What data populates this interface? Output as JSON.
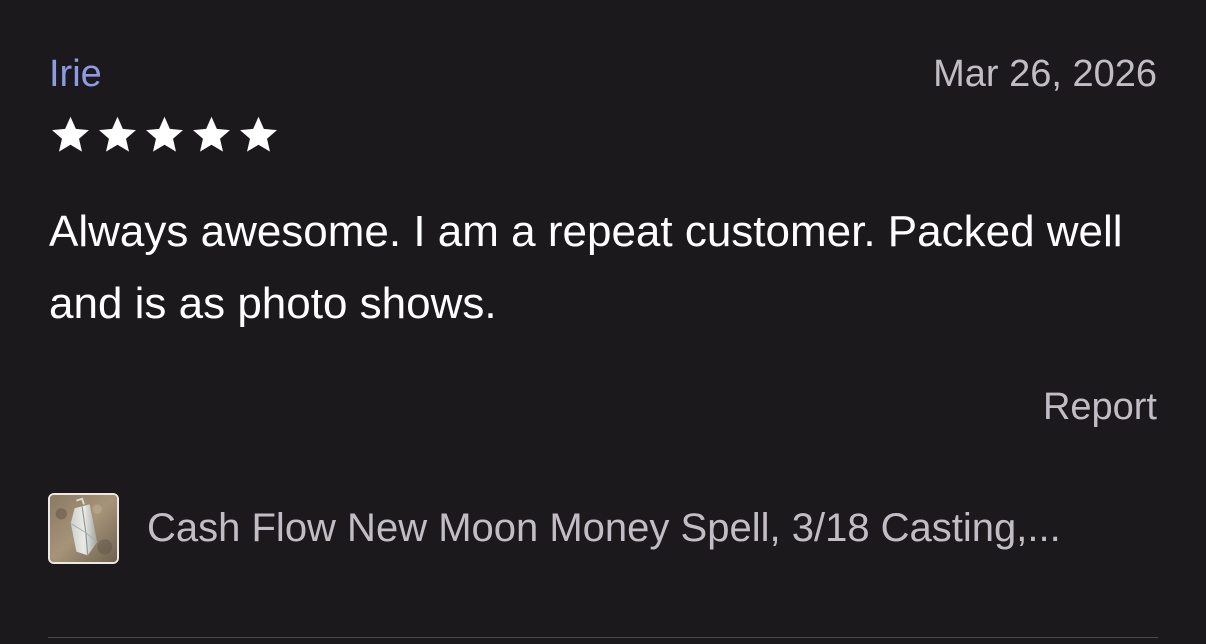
{
  "review": {
    "reviewer_name": "Irie",
    "date": "Mar 26, 2026",
    "rating": 5,
    "rating_max": 5,
    "text": "Always awesome. I am a repeat customer. Packed well and is as photo shows.",
    "report_label": "Report",
    "star_icon": "star-filled-icon"
  },
  "product": {
    "title": "Cash Flow New Moon Money Spell, 3/18 Casting,..."
  },
  "colors": {
    "background": "#1c191d",
    "reviewer_name": "#8c9be3",
    "muted_text": "#c2bcc4",
    "body_text": "#ffffff",
    "star": "#ffffff"
  }
}
